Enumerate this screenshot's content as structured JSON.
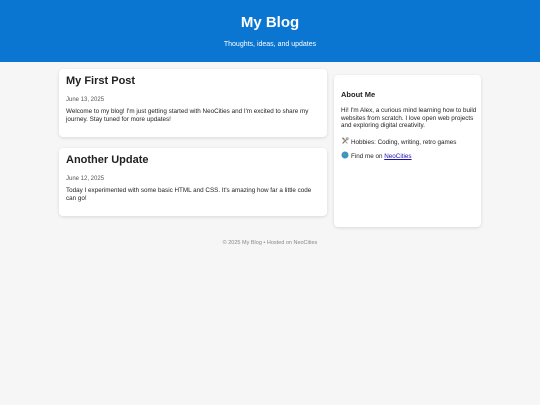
{
  "header": {
    "title": "My Blog",
    "tagline": "Thoughts, ideas, and updates",
    "background_color": "#0a76d1"
  },
  "posts": [
    {
      "title": "My First Post",
      "date": "June 13, 2025",
      "body": "Welcome to my blog! I'm just getting started with NeoCities and I'm excited to share my journey. Stay tuned for more updates!"
    },
    {
      "title": "Another Update",
      "date": "June 12, 2025",
      "body": "Today I experimented with some basic HTML and CSS. It's amazing how far a little code can go!"
    }
  ],
  "about": {
    "heading": "About Me",
    "intro": "Hi! I'm Alex, a curious mind learning how to build websites from scratch. I love open web projects and exploring digital creativity.",
    "hobbies_icon": "hammer-and-wrench-icon",
    "hobbies": "Hobbies: Coding, writing, retro games",
    "find_icon": "globe-icon",
    "find_prefix": "Find me on ",
    "find_link": "NeoCities",
    "link_color": "#1a0dab"
  },
  "footer": {
    "text": "© 2025 My Blog • Hosted on NeoCities"
  }
}
